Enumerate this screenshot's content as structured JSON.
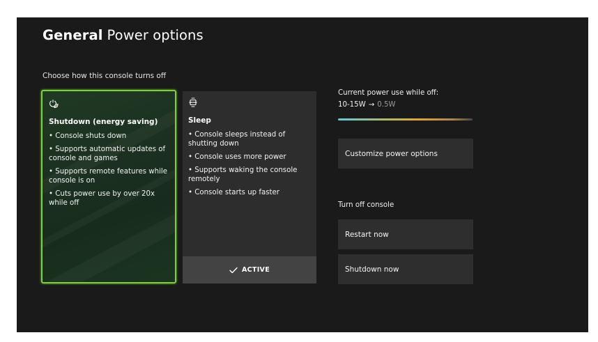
{
  "header": {
    "section": "General",
    "page": "Power options"
  },
  "main": {
    "subheading": "Choose how this console turns off",
    "modes": [
      {
        "icon": "power-leaf-icon",
        "title": "Shutdown (energy saving)",
        "selected": true,
        "bullets": [
          "• Console shuts down",
          "• Supports automatic updates of console and games",
          "• Supports remote features while console is on",
          "• Cuts power use by over 20x while off"
        ]
      },
      {
        "icon": "sleep-console-icon",
        "title": "Sleep",
        "status": "ACTIVE",
        "bullets": [
          "• Console sleeps instead of shutting down",
          "• Console uses more power",
          "• Supports waking the console remotely",
          "• Console starts up faster"
        ]
      }
    ]
  },
  "power_use": {
    "label": "Current power use while off:",
    "current": "10-15W",
    "arrow": "→",
    "target": "0.5W"
  },
  "actions": {
    "customize": "Customize power options",
    "turn_off_heading": "Turn off console",
    "restart": "Restart now",
    "shutdown": "Shutdown now"
  },
  "colors": {
    "background": "#1a1a1a",
    "selection_accent": "#7dd03a",
    "tile": "#2e2e2e",
    "active_bar": "#434343"
  }
}
